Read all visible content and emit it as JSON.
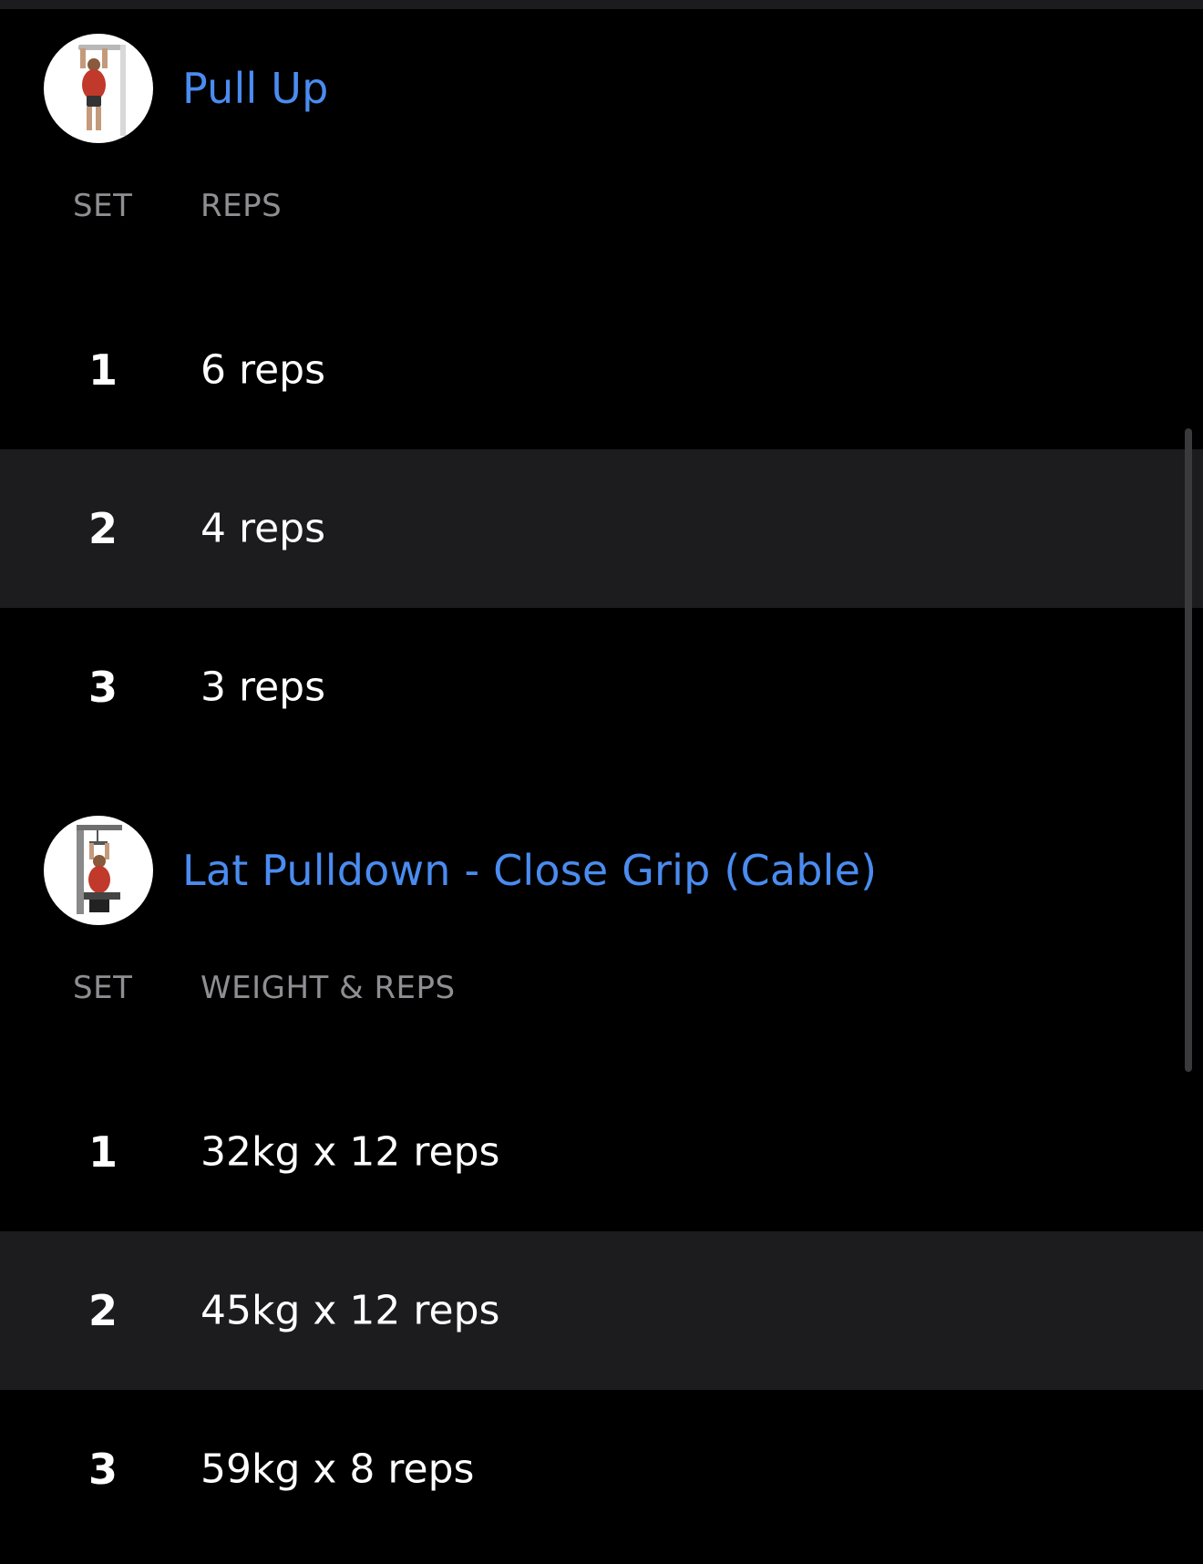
{
  "exercises": [
    {
      "title": "Pull Up",
      "thumbnail_icon": "pull-up-exercise-icon",
      "columns": {
        "set": "SET",
        "value": "REPS"
      },
      "sets": [
        {
          "set": "1",
          "value": "6 reps"
        },
        {
          "set": "2",
          "value": "4 reps"
        },
        {
          "set": "3",
          "value": "3 reps"
        }
      ]
    },
    {
      "title": "Lat Pulldown - Close Grip (Cable)",
      "thumbnail_icon": "lat-pulldown-exercise-icon",
      "columns": {
        "set": "SET",
        "value": "WEIGHT & REPS"
      },
      "sets": [
        {
          "set": "1",
          "value": "32kg x 12 reps"
        },
        {
          "set": "2",
          "value": "45kg x 12 reps"
        },
        {
          "set": "3",
          "value": "59kg x 8 reps"
        }
      ]
    }
  ],
  "colors": {
    "background": "#000000",
    "alt_row": "#1c1c1e",
    "accent_title": "#4a8cf0",
    "header_text": "#8e8e93",
    "primary_text": "#ffffff"
  }
}
